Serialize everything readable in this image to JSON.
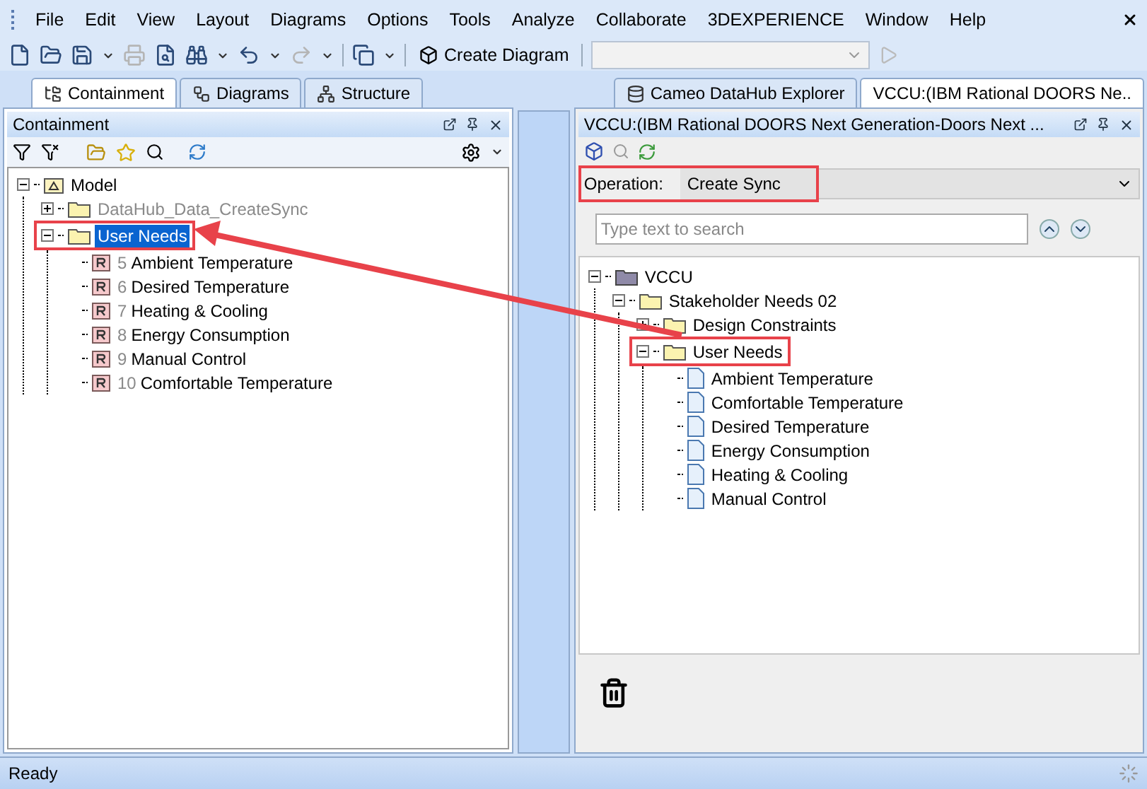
{
  "menu": [
    "File",
    "Edit",
    "View",
    "Layout",
    "Diagrams",
    "Options",
    "Tools",
    "Analyze",
    "Collaborate",
    "3DEXPERIENCE",
    "Window",
    "Help"
  ],
  "toolbar": {
    "create_diagram": "Create Diagram"
  },
  "left_panel": {
    "tabs": [
      {
        "label": "Containment",
        "selected": true
      },
      {
        "label": "Diagrams",
        "selected": false
      },
      {
        "label": "Structure",
        "selected": false
      }
    ],
    "title": "Containment",
    "tree": [
      {
        "kind": "model",
        "label": "Model",
        "expanded": true,
        "selected": false,
        "children": [
          {
            "kind": "package",
            "label": "DataHub_Data_CreateSync",
            "expanded": false,
            "greyed": true,
            "selected": false
          },
          {
            "kind": "package",
            "label": "User Needs",
            "expanded": true,
            "selected": true,
            "highlighted": true,
            "children": [
              {
                "kind": "requirement",
                "number": "5",
                "label": "Ambient Temperature",
                "selected": false
              },
              {
                "kind": "requirement",
                "number": "6",
                "label": "Desired Temperature",
                "selected": false
              },
              {
                "kind": "requirement",
                "number": "7",
                "label": "Heating & Cooling",
                "selected": false
              },
              {
                "kind": "requirement",
                "number": "8",
                "label": "Energy Consumption",
                "selected": false
              },
              {
                "kind": "requirement",
                "number": "9",
                "label": "Manual Control",
                "selected": false
              },
              {
                "kind": "requirement",
                "number": "10",
                "label": "Comfortable Temperature",
                "selected": false
              }
            ]
          }
        ]
      }
    ]
  },
  "right_panel": {
    "tabs": [
      {
        "label": "Cameo DataHub Explorer",
        "selected": false
      },
      {
        "label": "VCCU:(IBM Rational DOORS Ne..",
        "selected": true
      }
    ],
    "title": "VCCU:(IBM Rational DOORS Next Generation-Doors Next ...",
    "operation": {
      "label": "Operation:",
      "value": "Create Sync",
      "highlighted": true
    },
    "search": {
      "placeholder": "Type text to search"
    },
    "tree": [
      {
        "kind": "project",
        "label": "VCCU",
        "expanded": true,
        "children": [
          {
            "kind": "package",
            "label": "Stakeholder Needs 02",
            "expanded": true,
            "children": [
              {
                "kind": "package",
                "label": "Design Constraints",
                "expanded": false
              },
              {
                "kind": "package",
                "label": "User Needs",
                "expanded": true,
                "highlighted": true,
                "children": [
                  {
                    "kind": "document",
                    "label": "Ambient Temperature"
                  },
                  {
                    "kind": "document",
                    "label": "Comfortable Temperature"
                  },
                  {
                    "kind": "document",
                    "label": "Desired Temperature"
                  },
                  {
                    "kind": "document",
                    "label": "Energy Consumption"
                  },
                  {
                    "kind": "document",
                    "label": "Heating & Cooling"
                  },
                  {
                    "kind": "document",
                    "label": "Manual Control"
                  }
                ]
              }
            ]
          }
        ]
      }
    ]
  },
  "status_bar": {
    "text": "Ready"
  }
}
